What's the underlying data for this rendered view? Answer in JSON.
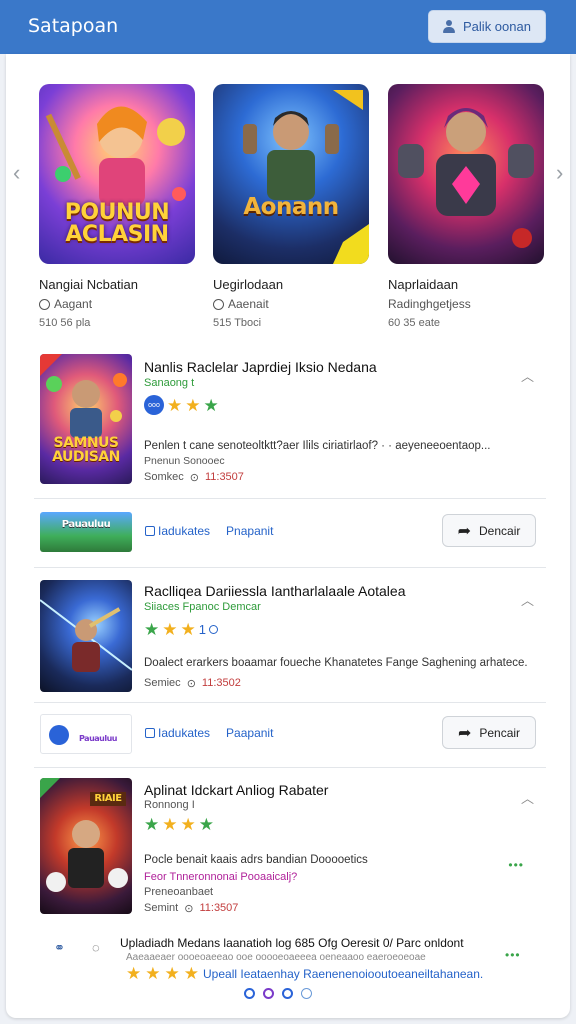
{
  "header": {
    "title": "Satapoan",
    "button_label": "Palik oonan",
    "button_icon": "user-icon",
    "color": "#3a78c9"
  },
  "carousel": {
    "items": [
      {
        "logo": "POUNUN ACLASIN",
        "title": "Nangiai Ncbatian",
        "subtitle": "Aagant",
        "meta": "510 56 pla"
      },
      {
        "logo": "Aonann",
        "title": "Uegirlodaan",
        "subtitle": "Aaenait",
        "meta": "515 Tboci"
      },
      {
        "logo": "",
        "title": "Naprlaidaan",
        "subtitle": "Radinghgetjess",
        "meta": "60 35 eate"
      }
    ]
  },
  "cards": [
    {
      "title": "Nanlis Raclelar Japrdiej Iksio Nedana",
      "subtitle": "Sanaong t",
      "logo": "SAMNUS AUDISAN",
      "badge": "ooo",
      "description_1": "Penlen t cane senoteoltktt?aer Ilils ciriatirlaof? · · aeyeneeoentaop...",
      "description_2": "Pnenun Sonooec",
      "meta_author": "Somkec",
      "meta_time": "11:3507"
    },
    {
      "title": "Raclliqea Dariiessla Iantharlalaale Aotalea",
      "subtitle": "Siiaces Fpanoc Demcar",
      "rating_num": "1",
      "description_1": "Doalect erarkers boaamar foueche Khanatetes Fange Saghening arhatece.",
      "meta_author": "Semiec",
      "meta_time": "11:3502"
    },
    {
      "title": "Aplinat Idckart Anliog Rabater",
      "subtitle": "Ronnong I",
      "logo": "RIAIE",
      "description_1": "Pocle benait kaais adrs bandian Dooooetics",
      "description_2": "Feor Tnneronnonai Pooaaicalj?",
      "description_3": "Preneoanbaet",
      "meta_author": "Semint",
      "meta_time": "11:3507"
    }
  ],
  "action_rows": [
    {
      "link_1": "Iadukates",
      "link_2": "Pnapanit",
      "button_label": "Dencair",
      "thumb_text": "Pauauluu"
    },
    {
      "link_1": "Iadukates",
      "link_2": "Paapanit",
      "button_label": "Pencair",
      "thumb_text": "Pauauluu"
    }
  ],
  "footer": {
    "line_1": "Upladiadh Medans laanatioh log 685 Ofg Oeresit 0/ Parc onldont",
    "line_2": "Aaeaaeaer oooeoaeeao ooe ooooeoaeeea oeneaaoo eaeroeoeoae",
    "line_3": "Upeall Ieataenhay Raenenenoiooutoeaneiltahanean.",
    "pages": 4,
    "active_page": 1
  },
  "accent_colors": {
    "link": "#2563c9",
    "rating": "#f2b01e",
    "green": "#3aa54a"
  }
}
